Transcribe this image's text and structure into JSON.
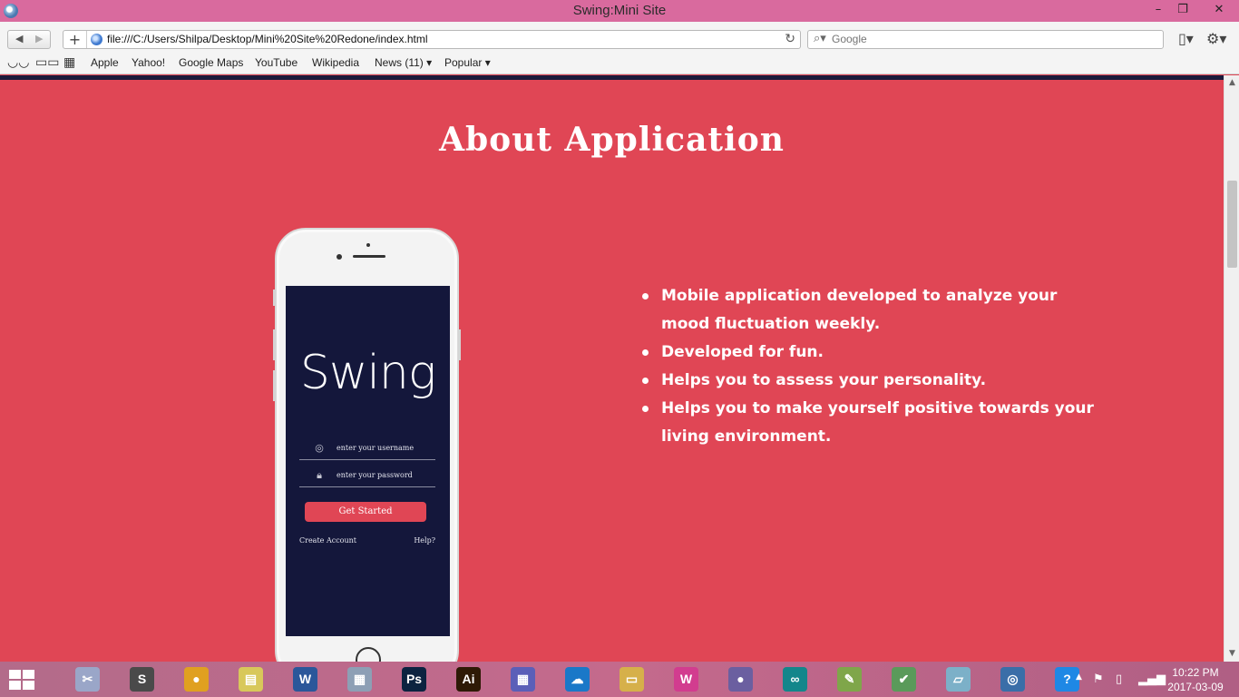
{
  "window": {
    "title": "Swing:Mini Site",
    "minimize": "–",
    "restore": "❐",
    "close": "✕"
  },
  "toolbar": {
    "back": "◀",
    "forward": "▶",
    "add": "+",
    "url": "file:///C:/Users/Shilpa/Desktop/Mini%20Site%20Redone/index.html",
    "reload": "↻",
    "search_placeholder": "Google",
    "search_icon": "magnifier-icon",
    "page_menu": "page-menu-icon",
    "settings_menu": "gear-icon"
  },
  "bookmarks": {
    "items": [
      {
        "label": "Apple"
      },
      {
        "label": "Yahoo!"
      },
      {
        "label": "Google Maps"
      },
      {
        "label": "YouTube"
      },
      {
        "label": "Wikipedia"
      },
      {
        "label": "News (11) ▾"
      },
      {
        "label": "Popular ▾"
      }
    ]
  },
  "page": {
    "title": "About Application",
    "features": [
      "Mobile application developed to analyze your mood fluctuation weekly.",
      "Developed for fun.",
      "Helps you to assess your personality.",
      "Helps you to make yourself positive towards your living environment."
    ]
  },
  "phone": {
    "logo": "Swing",
    "username_placeholder": "enter your username",
    "password_placeholder": "enter your password",
    "button": "Get Started",
    "create_account": "Create Account",
    "help": "Help?"
  },
  "taskbar": {
    "apps": [
      {
        "name": "snipping-tool",
        "label": "✂",
        "color": "#9aa6c8"
      },
      {
        "name": "sublime-text",
        "label": "S",
        "color": "#4a4a4a"
      },
      {
        "name": "chrome",
        "label": "●",
        "color": "#e0a020"
      },
      {
        "name": "sticky-notes",
        "label": "▤",
        "color": "#d8c85a"
      },
      {
        "name": "word",
        "label": "W",
        "color": "#2b579a"
      },
      {
        "name": "calculator",
        "label": "▦",
        "color": "#8d9fb5"
      },
      {
        "name": "photoshop",
        "label": "Ps",
        "color": "#0c2340"
      },
      {
        "name": "illustrator",
        "label": "Ai",
        "color": "#2e1a06"
      },
      {
        "name": "calendar",
        "label": "▦",
        "color": "#5b5fb8"
      },
      {
        "name": "onedrive",
        "label": "☁",
        "color": "#1a78c8"
      },
      {
        "name": "file-explorer",
        "label": "▭",
        "color": "#d6b04a"
      },
      {
        "name": "wamp",
        "label": "W",
        "color": "#d23c8f"
      },
      {
        "name": "github",
        "label": "●",
        "color": "#6b5fa0"
      },
      {
        "name": "arduino",
        "label": "∞",
        "color": "#13868b"
      },
      {
        "name": "notepad-plus",
        "label": "✎",
        "color": "#7fa64a"
      },
      {
        "name": "task-app",
        "label": "✔",
        "color": "#5a9a5a"
      },
      {
        "name": "notes-app",
        "label": "▱",
        "color": "#7cb0c8"
      },
      {
        "name": "safari",
        "label": "◎",
        "color": "#3a6ea8"
      },
      {
        "name": "help",
        "label": "?",
        "color": "#1e88e5"
      }
    ],
    "time": "10:22 PM",
    "date": "2017-03-09"
  }
}
